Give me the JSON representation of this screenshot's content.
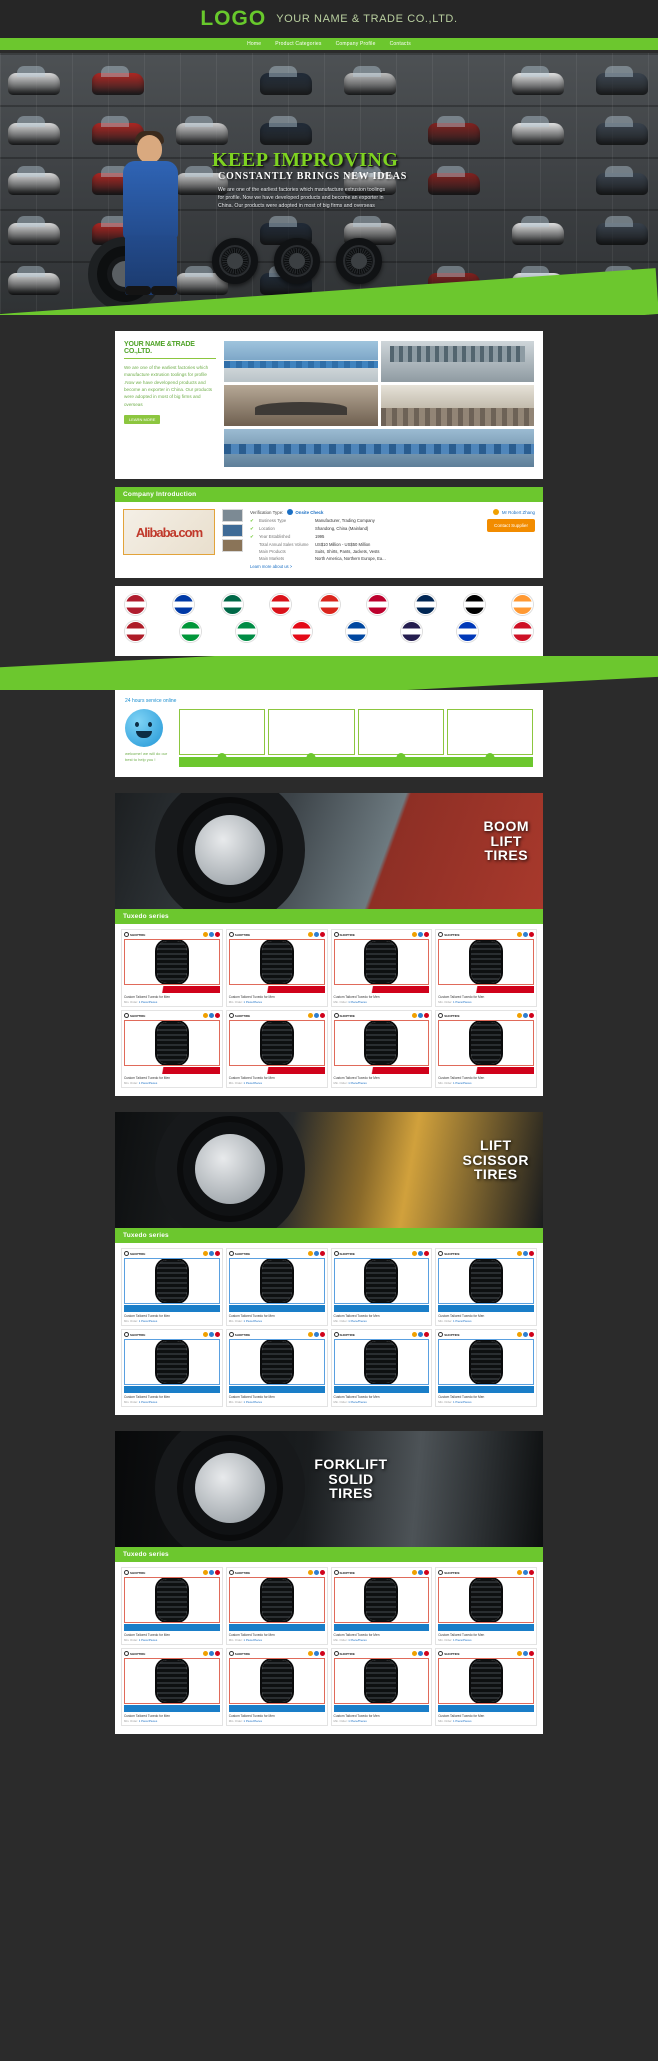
{
  "header": {
    "logo": "LOGO",
    "company_name": "YOUR NAME & TRADE CO.,LTD."
  },
  "nav": {
    "items": [
      {
        "label": "Home"
      },
      {
        "label": "Product Categories"
      },
      {
        "label": "Company Profile"
      },
      {
        "label": "Contacts"
      }
    ]
  },
  "hero": {
    "title": "KEEP IMPROVING",
    "subtitle": "CONSTANTLY BRINGS NEW IDEAS",
    "paragraph": "We are one of the earliest factories which manufacture extrusion toolings for profile. Now we have developed products and become an exporter in China. Our products were adopted in most of big firms and overseas"
  },
  "about": {
    "title": "YOUR NAME &TRADE CO.,LTD.",
    "body": "We are one of the earliest factories which manufacture extrusion toolings for profile .Now we have developend products and become an exporter in China. Our products were adopted in most of big firms and overseas",
    "learn_more": "LEARN MORE"
  },
  "company_intro": {
    "section_title": "Company Introduction",
    "badge_logo": "Alibaba.com",
    "verification_label": "Verification Type:",
    "onsite_check": "Onsite Check",
    "rows": [
      {
        "key": "Business Type",
        "value": "Manufacturer, Trading Company",
        "checked": true
      },
      {
        "key": "Location",
        "value": "Shandong, China (Mainland)",
        "checked": true
      },
      {
        "key": "Year Established",
        "value": "1995",
        "checked": true
      },
      {
        "key": "Total Annual Sales Volume",
        "value": "US$10 Million - US$50 Million",
        "checked": false
      },
      {
        "key": "Main Products",
        "value": "Suits, Shirts, Pants, Jackets, Vests",
        "checked": false
      },
      {
        "key": "Main Markets",
        "value": "North America, Northern Europe, Ea...",
        "checked": false
      }
    ],
    "learn_more": "Learn more about us >",
    "chat_label": "Mr Robert Zhang",
    "contact_button": "Contact Supplier"
  },
  "flags": {
    "row1": [
      "#b01c2e",
      "#0039a6",
      "#006847",
      "#da121a",
      "#da251d",
      "#bc002d",
      "#002654",
      "#000000",
      "#ff9933"
    ],
    "row2": [
      "#ae1c28",
      "#009639",
      "#008c45",
      "#e30a17",
      "#0047a0",
      "#241d4f",
      "#0038b8",
      "#ce1126"
    ]
  },
  "service": {
    "title": "24 hours service online",
    "note": "welcome! we will do our best to help you !",
    "boxes": 4
  },
  "categories": [
    {
      "title_lines": [
        "BOOM",
        "LIFT",
        "TIRES"
      ],
      "series_label": "Tuxedo series",
      "align": "right",
      "sash": "red",
      "frame": "panel-frame-1"
    },
    {
      "title_lines": [
        "LIFT",
        "SCISSOR",
        "TIRES"
      ],
      "series_label": "Tuxedo series",
      "align": "right",
      "sash": "blue",
      "frame": "panel-frame-2"
    },
    {
      "title_lines": [
        "FORKLIFT",
        "SOLID",
        "TIRES"
      ],
      "series_label": "Tuxedo series",
      "align": "center",
      "sash": "grid",
      "frame": "panel-frame-3"
    }
  ],
  "product": {
    "brand": "SHOPTIRE",
    "name": "Custom Tailored Tuxedo for Men",
    "meta_key": "Min. Order:",
    "meta_val": "1 Piece/Pieces",
    "icon_colors": [
      "#f0a000",
      "#2f7fd0",
      "#d0021b",
      "#6cc72e",
      "#9b59b6",
      "#e67e22"
    ],
    "count_per_section": 8
  }
}
